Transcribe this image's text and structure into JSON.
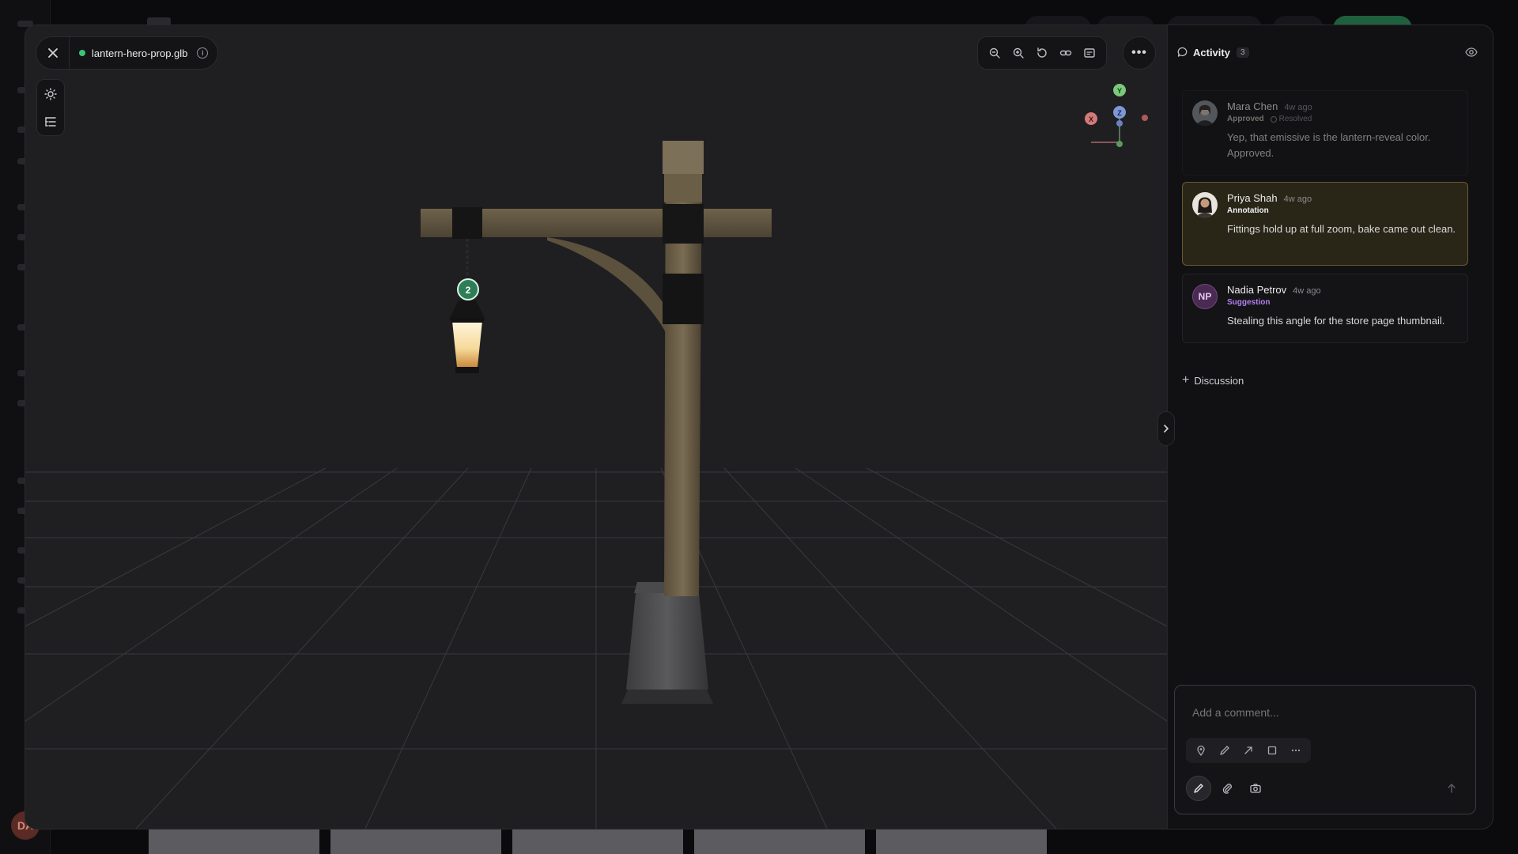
{
  "file": {
    "name": "lantern-hero-prop.glb",
    "status_color": "#3ec27a"
  },
  "viewport": {
    "annotation_marker": "2",
    "gizmo": {
      "y_label": "Y",
      "x_label": "X",
      "z_label": "Z"
    },
    "top_tools": [
      "zoom-out-icon",
      "zoom-in-icon",
      "reset-view-icon",
      "link-icon",
      "frame-icon"
    ],
    "side_tools": [
      "lighting-icon",
      "outline-icon"
    ]
  },
  "background": {
    "avatar_initials": "DA"
  },
  "activity": {
    "title": "Activity",
    "count": "3",
    "comments": [
      {
        "author": "Mara Chen",
        "time": "4w ago",
        "tag": "Approved",
        "tag_color": "#b9c2b0",
        "resolved_label": "Resolved",
        "text": "Yep, that emissive is the lantern-reveal color. Approved."
      },
      {
        "author": "Priya Shah",
        "time": "4w ago",
        "tag": "Annotation",
        "tag_color": "#f1f1f1",
        "text": "Fittings hold up at full zoom, bake came out clean."
      },
      {
        "author": "Nadia Petrov",
        "initials": "NP",
        "time": "4w ago",
        "tag": "Suggestion",
        "tag_color": "#b37ff0",
        "text": "Stealing this angle for the store page thumbnail."
      }
    ],
    "discussion_label": "Discussion",
    "composer": {
      "placeholder": "Add a comment...",
      "markup_tools": [
        "pin-icon",
        "pen-icon",
        "arrow-icon",
        "rectangle-icon",
        "more-icon"
      ],
      "actions": [
        "pencil-icon",
        "attach-icon",
        "camera-icon"
      ]
    }
  }
}
